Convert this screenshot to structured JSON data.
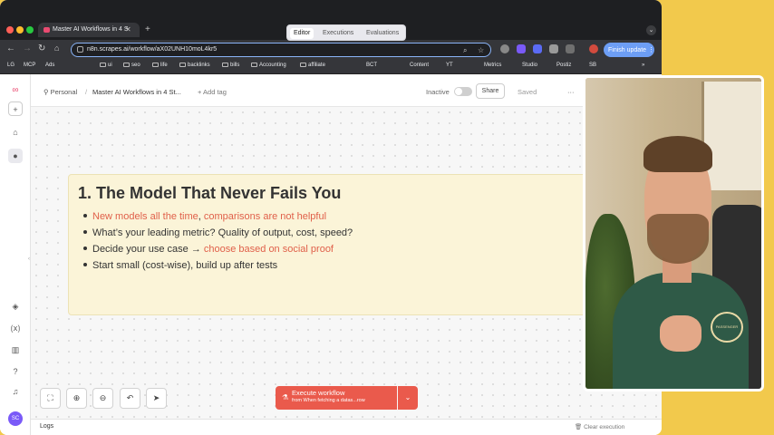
{
  "browser": {
    "tab_title": "Master AI Workflows in 4 S",
    "url": "n8n.scrapes.ai/workflow/aX02UNH10moL4kr5",
    "finish_update": "Finish update",
    "bookmarks": [
      "LG",
      "MCP",
      "Ads",
      "ui",
      "seo",
      "life",
      "backlinks",
      "bills",
      "Accounting",
      "affiliate",
      "BCT",
      "Content",
      "YT",
      "Metrics",
      "Studio",
      "Postiz",
      "SB"
    ]
  },
  "header": {
    "personal": "Personal",
    "separator": "/",
    "workflow_name": "Master AI Workflows in 4 St...",
    "add_tag": "+ Add tag",
    "inactive": "Inactive",
    "share": "Share",
    "saved": "Saved",
    "more": "···"
  },
  "tabs": [
    "Editor",
    "Executions",
    "Evaluations"
  ],
  "note": {
    "title": "1. The Model That Never Fails You",
    "bullets": [
      {
        "parts": [
          {
            "t": "New models all the time",
            "red": true
          },
          {
            "t": ", ",
            "red": false
          },
          {
            "t": "comparisons are not helpful",
            "red": true
          }
        ]
      },
      {
        "parts": [
          {
            "t": "What’s your leading metric? Quality of output, cost, speed?",
            "red": false
          }
        ]
      },
      {
        "parts": [
          {
            "t": "Decide your use case → ",
            "red": false
          },
          {
            "t": "choose based on social proof",
            "red": true
          }
        ]
      },
      {
        "parts": [
          {
            "t": "Start small (cost-wise), build up after tests",
            "red": false
          }
        ]
      }
    ]
  },
  "execute": {
    "label": "Execute workflow",
    "sub": "from When fetching a datas...row"
  },
  "footer": {
    "logs": "Logs",
    "clear": "Clear execution"
  },
  "webcam": {
    "shirt_text": "PASSENGER"
  },
  "colors": {
    "accent": "#ea5a4c",
    "note_bg": "#fbf4d8",
    "highlight_text": "#e0604a",
    "frame": "#f2c94c"
  }
}
